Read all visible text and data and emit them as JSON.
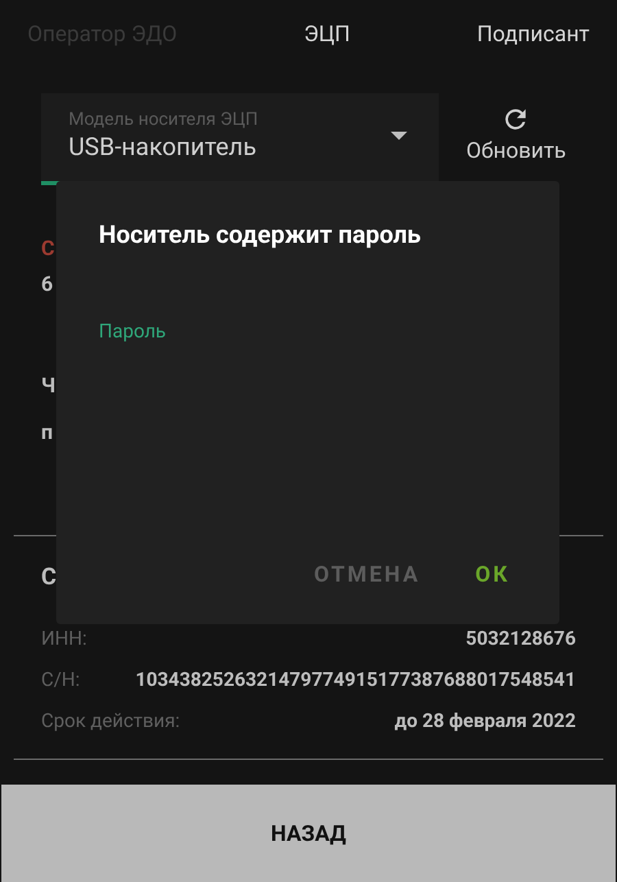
{
  "tabs": [
    {
      "label": "Оператор ЭДО",
      "disabled": true
    },
    {
      "label": "ЭЦП",
      "disabled": false
    },
    {
      "label": "Подписант",
      "disabled": false
    }
  ],
  "carrier_select": {
    "label": "Модель носителя ЭЦП",
    "value": "USB-накопитель"
  },
  "refresh_button": {
    "label": "Обновить"
  },
  "hidden_texts": [
    {
      "text": "С",
      "kind": "error"
    },
    {
      "text": "6",
      "kind": "bold"
    },
    {
      "text": "Ч",
      "kind": "bold"
    },
    {
      "text": "п",
      "kind": "bold"
    }
  ],
  "certificate": {
    "heading": "С",
    "rows": [
      {
        "label": "ИНН:",
        "value": "5032128676"
      },
      {
        "label": "С/Н:",
        "value": "1034382526321479774915177387688017548541"
      },
      {
        "label": "Срок действия:",
        "value": "до 28 февраля 2022"
      }
    ]
  },
  "back_button": {
    "label": "НАЗАД"
  },
  "dialog": {
    "title": "Носитель содержит пароль",
    "password_field": {
      "label": "Пароль"
    },
    "buttons": [
      {
        "label": "ОТМЕНА",
        "kind": "cancel"
      },
      {
        "label": "ОК",
        "kind": "confirm"
      }
    ]
  }
}
